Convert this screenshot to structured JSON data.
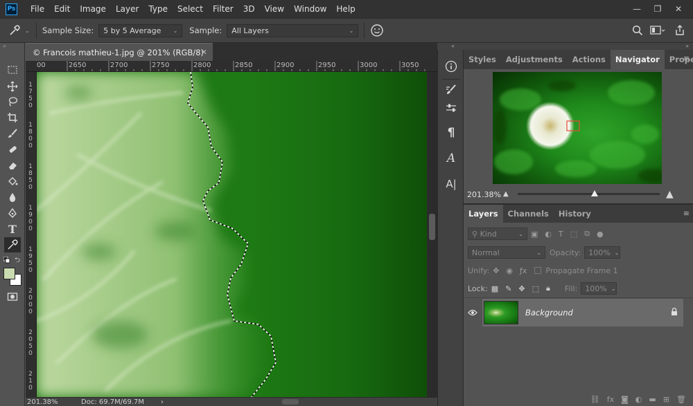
{
  "app": {
    "logo": "Ps"
  },
  "menu": [
    "File",
    "Edit",
    "Image",
    "Layer",
    "Type",
    "Select",
    "Filter",
    "3D",
    "View",
    "Window",
    "Help"
  ],
  "window_controls": {
    "minimize": "—",
    "restore": "❐",
    "close": "✕"
  },
  "options": {
    "sample_size_label": "Sample Size:",
    "sample_size_value": "5 by 5 Average",
    "sample_label": "Sample:",
    "sample_value": "All Layers"
  },
  "document": {
    "tab_title": "© Francois mathieu-1.jpg @ 201% (RGB/8)",
    "close": "✕",
    "hruler": [
      "00",
      "2650",
      "2700",
      "2750",
      "2800",
      "2850",
      "2900",
      "2950",
      "3000",
      "3050"
    ],
    "vruler": [
      {
        "digits": [
          "1",
          "7",
          "5",
          "0"
        ]
      },
      {
        "digits": [
          "1",
          "8",
          "0",
          "0"
        ]
      },
      {
        "digits": [
          "1",
          "8",
          "5",
          "0"
        ]
      },
      {
        "digits": [
          "1",
          "9",
          "0",
          "0"
        ]
      },
      {
        "digits": [
          "1",
          "9",
          "5",
          "0"
        ]
      },
      {
        "digits": [
          "2",
          "0",
          "0",
          "0"
        ]
      },
      {
        "digits": [
          "2",
          "0",
          "5",
          "0"
        ]
      },
      {
        "digits": [
          "2",
          "1",
          "0"
        ]
      }
    ],
    "zoom": "201.38%",
    "doc_info": "Doc: 69.7M/69.7M",
    "status_arrow": "›"
  },
  "panels": {
    "tabs": [
      "Styles",
      "Adjustments",
      "Actions",
      "Navigator",
      "Properties"
    ],
    "active_tab": "Navigator",
    "navigator": {
      "zoom": "201.38%",
      "slider_level": 0.54
    }
  },
  "layers": {
    "tabs": [
      "Layers",
      "Channels",
      "History"
    ],
    "kind": "Kind",
    "blend_mode": "Normal",
    "opacity_label": "Opacity:",
    "opacity_value": "100%",
    "unify_label": "Unify:",
    "propagate_label": "Propagate Frame 1",
    "lock_label": "Lock:",
    "fill_label": "Fill:",
    "fill_value": "100%",
    "layer_name": "Background"
  },
  "colors": {
    "foreground": "#c9dcb0",
    "background": "#ffffff",
    "accent": "#31a8ff"
  }
}
